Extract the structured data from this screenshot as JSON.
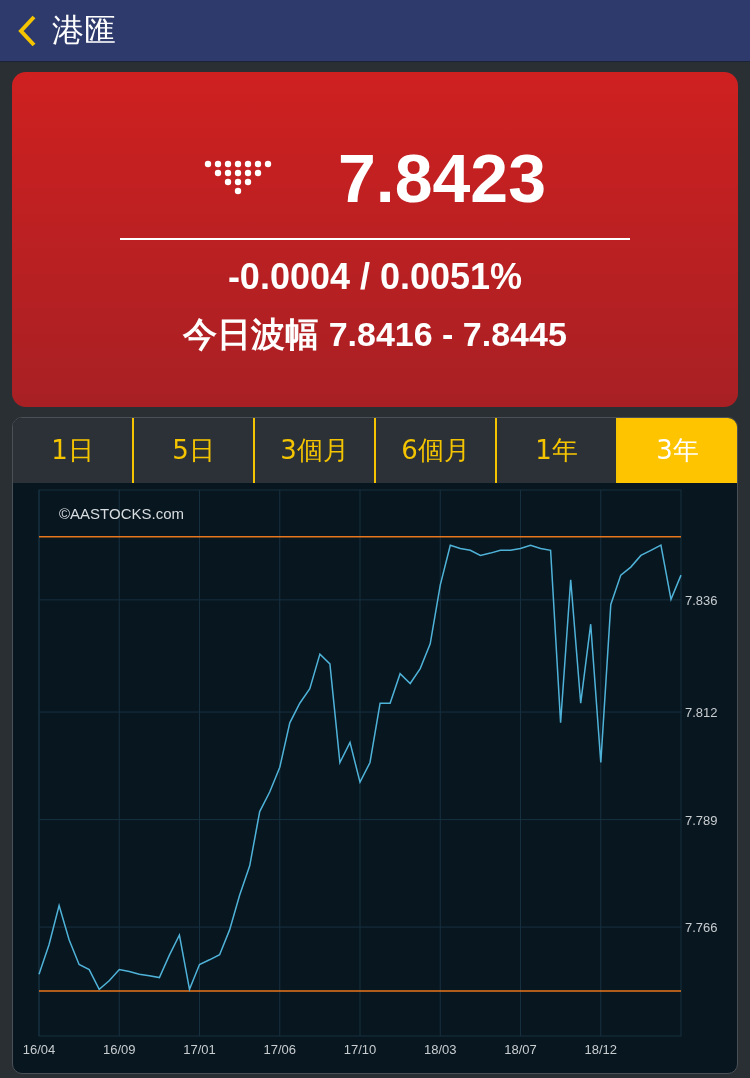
{
  "header": {
    "title": "港匯"
  },
  "quote": {
    "falling": true,
    "price": "7.8423",
    "change": "-0.0004 / 0.0051%",
    "range_label": "今日波幅",
    "range": "7.8416 - 7.8445"
  },
  "tabs": [
    {
      "label": "1日",
      "selected": false
    },
    {
      "label": "5日",
      "selected": false
    },
    {
      "label": "3個月",
      "selected": false
    },
    {
      "label": "6個月",
      "selected": false
    },
    {
      "label": "1年",
      "selected": false
    },
    {
      "label": "3年",
      "selected": true
    }
  ],
  "chart": {
    "credit": "©AASTOCKS.com",
    "chart_data": {
      "type": "line",
      "categories": [
        "16/04",
        null,
        null,
        null,
        null,
        null,
        null,
        null,
        "16/09",
        null,
        null,
        null,
        null,
        null,
        null,
        null,
        "17/01",
        null,
        null,
        null,
        null,
        null,
        null,
        null,
        "17/06",
        null,
        null,
        null,
        null,
        null,
        null,
        null,
        "17/10",
        null,
        null,
        null,
        null,
        null,
        null,
        null,
        "18/03",
        null,
        null,
        null,
        null,
        null,
        null,
        null,
        "18/07",
        null,
        null,
        null,
        null,
        null,
        null,
        null,
        "18/12",
        null,
        null,
        null,
        null,
        null,
        null,
        null,
        null
      ],
      "series": [
        {
          "color": "#4fb3d9",
          "values": [
            7.7559,
            7.7622,
            7.7706,
            7.7633,
            7.758,
            7.7569,
            7.7527,
            7.7545,
            7.7569,
            7.7565,
            7.7559,
            7.7556,
            7.7552,
            7.76,
            7.7643,
            7.7527,
            7.758,
            7.759,
            7.7601,
            7.7654,
            7.7728,
            7.7791,
            7.7907,
            7.7949,
            7.8002,
            7.8097,
            7.8139,
            7.817,
            7.8244,
            7.8223,
            7.8012,
            7.8055,
            7.797,
            7.8012,
            7.8139,
            7.8139,
            7.8202,
            7.8181,
            7.8213,
            7.8266,
            7.8392,
            7.8477,
            7.847,
            7.8466,
            7.8455,
            7.846,
            7.8466,
            7.8466,
            7.847,
            7.8477,
            7.847,
            7.8466,
            7.8097,
            7.8403,
            7.8139,
            7.8308,
            7.8012,
            7.835,
            7.8413,
            7.843,
            7.8455,
            7.8466,
            7.8477,
            7.8361,
            7.8413
          ]
        }
      ],
      "ylim": [
        7.7427,
        7.8595
      ],
      "yticks": [
        {
          "value": 7.836,
          "label": "7.836"
        },
        {
          "value": 7.812,
          "label": "7.812"
        },
        {
          "value": 7.789,
          "label": "7.789"
        },
        {
          "value": 7.766,
          "label": "7.766"
        }
      ],
      "grid": true,
      "ref_lines": [
        {
          "axis": "y",
          "value": 7.8495,
          "color": "#e8761c"
        },
        {
          "axis": "y",
          "value": 7.7523,
          "color": "#e8761c"
        }
      ]
    }
  }
}
